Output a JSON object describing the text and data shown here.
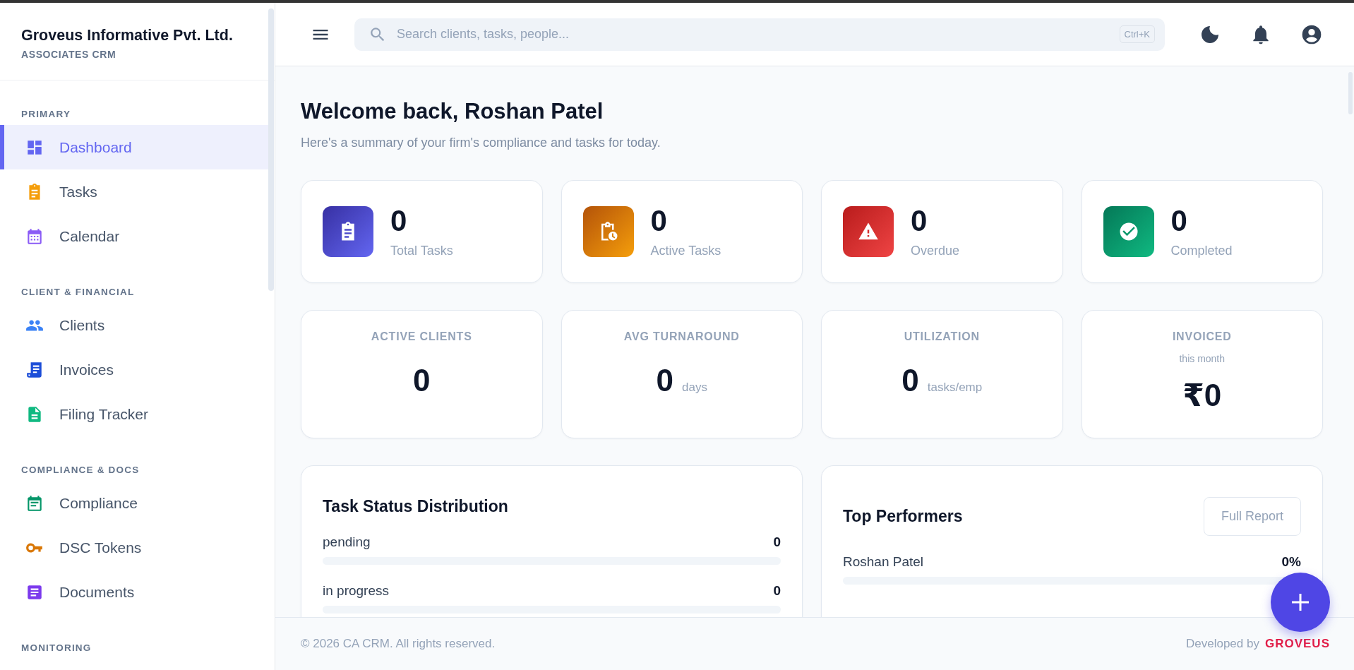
{
  "sidebar": {
    "company": "Groveus Informative Pvt. Ltd.",
    "subtitle": "ASSOCIATES CRM",
    "sections": [
      {
        "title": "PRIMARY",
        "items": [
          {
            "label": "Dashboard",
            "selected": true
          },
          {
            "label": "Tasks",
            "selected": false
          },
          {
            "label": "Calendar",
            "selected": false
          }
        ]
      },
      {
        "title": "CLIENT & FINANCIAL",
        "items": [
          {
            "label": "Clients",
            "selected": false
          },
          {
            "label": "Invoices",
            "selected": false
          },
          {
            "label": "Filing Tracker",
            "selected": false
          }
        ]
      },
      {
        "title": "COMPLIANCE & DOCS",
        "items": [
          {
            "label": "Compliance",
            "selected": false
          },
          {
            "label": "DSC Tokens",
            "selected": false
          },
          {
            "label": "Documents",
            "selected": false
          }
        ]
      },
      {
        "title": "MONITORING"
      }
    ]
  },
  "header": {
    "search": {
      "placeholder": "Search clients, tasks, people...",
      "shortcut": "Ctrl+K"
    }
  },
  "welcome": {
    "title": "Welcome back, Roshan Patel",
    "subtitle": "Here's a summary of your firm's compliance and tasks for today."
  },
  "stat_cards": [
    {
      "value": "0",
      "label": "Total Tasks"
    },
    {
      "value": "0",
      "label": "Active Tasks"
    },
    {
      "value": "0",
      "label": "Overdue"
    },
    {
      "value": "0",
      "label": "Completed"
    }
  ],
  "metrics": [
    {
      "label": "ACTIVE CLIENTS",
      "value": "0"
    },
    {
      "label": "AVG TURNAROUND",
      "value": "0",
      "unit": "days"
    },
    {
      "label": "UTILIZATION",
      "value": "0",
      "unit": "tasks/emp"
    },
    {
      "label": "INVOICED",
      "note": "this month",
      "value": "₹0"
    }
  ],
  "task_status": {
    "title": "Task Status Distribution",
    "rows": [
      {
        "label": "pending",
        "count": "0"
      },
      {
        "label": "in progress",
        "count": "0"
      }
    ]
  },
  "top_performers": {
    "title": "Top Performers",
    "button": "Full Report",
    "rows": [
      {
        "name": "Roshan Patel",
        "percent": "0%"
      }
    ]
  },
  "footer": {
    "copyright": "© 2026 CA CRM. All rights reserved.",
    "developed_by": "Developed by",
    "brand": "GROVEUS"
  }
}
